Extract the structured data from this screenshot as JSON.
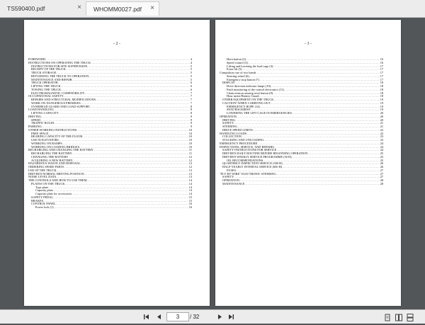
{
  "tabs": [
    {
      "label": "TS590400.pdf"
    },
    {
      "label": "WHOMM0027.pdf"
    }
  ],
  "left_page": {
    "number": "- 2 -",
    "entries": [
      {
        "text": "FOREWORD",
        "page": "4",
        "level": 1
      },
      {
        "text": "INSTRUCTIONS ON OPERATING THE TRUCK",
        "page": "4",
        "level": 1
      },
      {
        "text": "INSTRUCTIONS FOR SITE SUPERVISION",
        "page": "5",
        "level": 2
      },
      {
        "text": "RECEIPT OF THE TRUCK",
        "page": "5",
        "level": 2
      },
      {
        "text": "TRUCK STORAGE",
        "page": "5",
        "level": 2
      },
      {
        "text": "RETURNING THE TRUCK TO OPERATION",
        "page": "5",
        "level": 2
      },
      {
        "text": "MAINTENANCE AND REPAIR",
        "page": "5",
        "level": 2
      },
      {
        "text": "TRUCK OPERATOR",
        "page": "6",
        "level": 2
      },
      {
        "text": "LIFTING THE TRUCK",
        "page": "6",
        "level": 2
      },
      {
        "text": "TOWING THE TRUCK",
        "page": "6",
        "level": 2
      },
      {
        "text": "ELECTROMAGNETIC COMPATIBILITY",
        "page": "7",
        "level": 2
      },
      {
        "text": "OCCUPATIONAL SAFETY",
        "page": "7",
        "level": 1
      },
      {
        "text": "REPAIRS AND STRUCTURAL MODIFICATIONS",
        "page": "7",
        "level": 2
      },
      {
        "text": "WORK ON DANGEROUS PREMISES",
        "page": "7",
        "level": 2
      },
      {
        "text": "OVERHEAD GUARD AND LOAD SUPPORT",
        "page": "8",
        "level": 2
      },
      {
        "text": "LOAD HANDLING",
        "page": "8",
        "level": 1
      },
      {
        "text": "LIFTING CAPACITY",
        "page": "8",
        "level": 2
      },
      {
        "text": "DRIVING",
        "page": "9",
        "level": 1
      },
      {
        "text": "SPEED",
        "page": "9",
        "level": 2
      },
      {
        "text": "TRAFFIC RULES",
        "page": "9",
        "level": 2
      },
      {
        "text": "PARKING",
        "page": "9",
        "level": 1
      },
      {
        "text": "OTHER WORKING INSTRUCTIONS",
        "page": "10",
        "level": 1
      },
      {
        "text": "FREE SPACE",
        "page": "10",
        "level": 2
      },
      {
        "text": "BEARING CAPACITY OF THE FLOOR",
        "page": "10",
        "level": 2
      },
      {
        "text": "USE IN ELEVATORS",
        "page": "10",
        "level": 2
      },
      {
        "text": "WORKING ON RAMPS",
        "page": "10",
        "level": 2
      },
      {
        "text": "WORKING ON LOADING BRIDGES",
        "page": "10",
        "level": 2
      },
      {
        "text": "RECHARGING AND CHANGING THE BATTERY",
        "page": "11",
        "level": 1
      },
      {
        "text": "RECHARGING THE BATTERY",
        "page": "11",
        "level": 2
      },
      {
        "text": "CHANGING THE BATTERY",
        "page": "12",
        "level": 2
      },
      {
        "text": "ACQUIRING A NEW BATTERY",
        "page": "12",
        "level": 2
      },
      {
        "text": "HAZARDOUS WASTE AND DISPOSAL",
        "page": "12",
        "level": 1
      },
      {
        "text": "ORDERING SPARE PARTS",
        "page": "12",
        "level": 1
      },
      {
        "text": "USE OF THE TRUCK",
        "page": "13",
        "level": 1
      },
      {
        "text": "DRIVER'S NORMAL DRIVING POSITION",
        "page": "13",
        "level": 1
      },
      {
        "text": "NOISE LEVEL DATA",
        "page": "13",
        "level": 1
      },
      {
        "text": "THE CONTROLS AND HOW TO USE THEM",
        "page": "14",
        "level": 1
      },
      {
        "text": "PLATES ON THE TRUCK",
        "page": "14",
        "level": 2
      },
      {
        "text": "Type plate",
        "page": "14",
        "level": 3
      },
      {
        "text": "Capacity plate",
        "page": "14",
        "level": 3
      },
      {
        "text": "Capacity plate for accessories",
        "page": "14",
        "level": 3
      },
      {
        "text": "SAFETY PEDAL",
        "page": "15",
        "level": 2
      },
      {
        "text": "BRAKES",
        "page": "15",
        "level": 2
      },
      {
        "text": "CONTROL PANEL",
        "page": "16",
        "level": 2
      },
      {
        "text": "Power lock (1)",
        "page": "16",
        "level": 3
      }
    ]
  },
  "right_page": {
    "number": "- 3 -",
    "entries": [
      {
        "text": "Horn button (2)",
        "page": "16",
        "level": 3
      },
      {
        "text": "Speed control (3)",
        "page": "16",
        "level": 3
      },
      {
        "text": "Lifting and lowering the load cage (4)",
        "page": "17",
        "level": 3
      },
      {
        "text": "Extra lift (5)",
        "page": "17",
        "level": 3
      },
      {
        "text": "Compulsory use of two hands",
        "page": "17",
        "level": 1
      },
      {
        "text": "Steering wheel (6)",
        "page": "17",
        "level": 3
      },
      {
        "text": "Emergency stop button (7)",
        "page": "17",
        "level": 3
      },
      {
        "text": "DISPLAY",
        "page": "18",
        "level": 2
      },
      {
        "text": "Drive direction indicator lamps (10)",
        "page": "18",
        "level": 3
      },
      {
        "text": "Fault monitoring of the control electronics (11)",
        "page": "18",
        "level": 3
      },
      {
        "text": "Chain tension sensing reset button (8)",
        "page": "18",
        "level": 3
      },
      {
        "text": "Hour meter/Battery Guard",
        "page": "18",
        "level": 3
      },
      {
        "text": "OTHER EQUIPMENT ON THE TRUCK",
        "page": "19",
        "level": 2
      },
      {
        "text": "CAUTION! WHEN CARRYING OUT",
        "page": "19",
        "level": 2
      },
      {
        "text": "EMERGENCY ROPE (14)",
        "page": "19",
        "level": 3
      },
      {
        "text": "SEAT/BACKREST",
        "page": "19",
        "level": 3
      },
      {
        "text": "LOWERING THE LIFT CAGE IN EMERGENCIES",
        "page": "20",
        "level": 3
      },
      {
        "text": "OPERATION",
        "page": "20",
        "level": 1
      },
      {
        "text": "DRIVING",
        "page": "20",
        "level": 2
      },
      {
        "text": "SAFETY",
        "page": "21",
        "level": 2
      },
      {
        "text": "STEERING",
        "page": "21",
        "level": 2
      },
      {
        "text": "DRIVE SPEED LIMITS",
        "page": "22",
        "level": 2
      },
      {
        "text": "HANDLING LOADS",
        "page": "22",
        "level": 1
      },
      {
        "text": "COLLECTION",
        "page": "23",
        "level": 2
      },
      {
        "text": "STACKING AND UNLOADING",
        "page": "23",
        "level": 2
      },
      {
        "text": "EMERGENCY PROCEDURE",
        "page": "24",
        "level": 1
      },
      {
        "text": "INSPECTIONS, SERVICE, AND REPAIRS",
        "page": "24",
        "level": 1
      },
      {
        "text": "SAFETY INSTRUCTIONS FOR SERVICE",
        "page": "24",
        "level": 2
      },
      {
        "text": "DRIVER'S DAILY ROUTINE BEFORE BEGINNING OPERATION",
        "page": "25",
        "level": 2
      },
      {
        "text": "DRIVER'S WEEKLY SERVICE PROGRAMME (50 H)",
        "page": "25",
        "level": 2
      },
      {
        "text": "OIL RECOMMENDATIONS",
        "page": "25",
        "level": 3
      },
      {
        "text": "QUARTERLY INSPECTION SERVICE (300 H)",
        "page": "26",
        "level": 2
      },
      {
        "text": "HALF-YEARLY INTERVAL SERVICE (600 H)",
        "page": "26",
        "level": 2
      },
      {
        "text": "FUSES",
        "page": "27",
        "level": 3
      },
      {
        "text": "\"FLY BY WIRE\" ELECTRONIC STEERING",
        "page": "27",
        "level": 1
      },
      {
        "text": "SAFETY",
        "page": "27",
        "level": 2
      },
      {
        "text": "OPERATION",
        "page": "28",
        "level": 2
      },
      {
        "text": "MAINTENANCE",
        "page": "28",
        "level": 2
      }
    ]
  },
  "navigation": {
    "current_page": "3",
    "total_pages": "/ 32"
  }
}
